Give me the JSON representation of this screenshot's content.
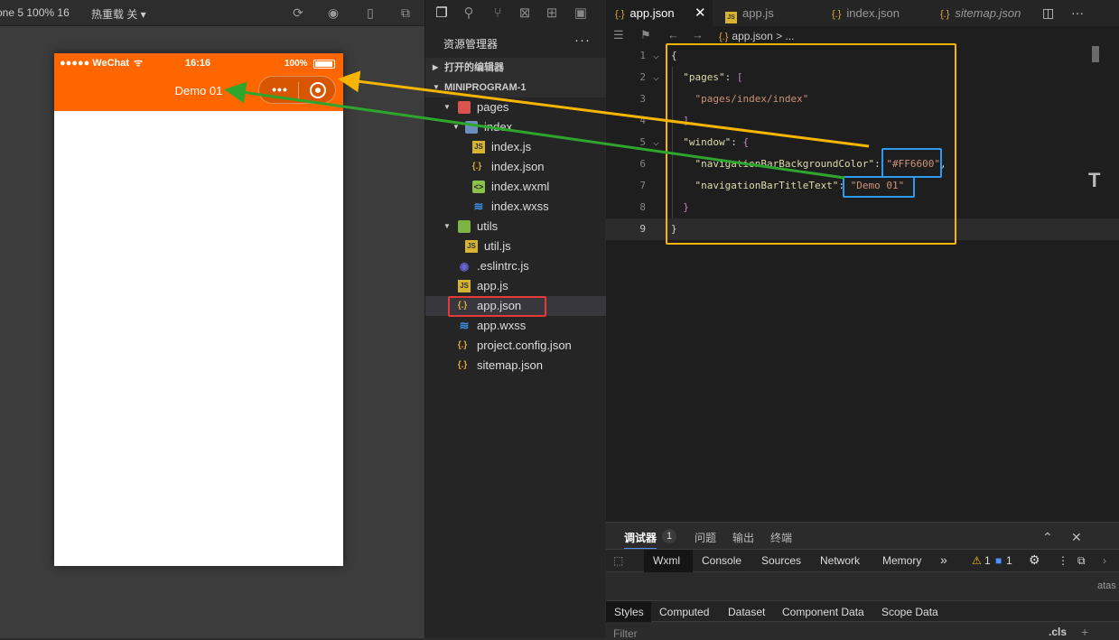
{
  "simulator": {
    "toolbar": {
      "device": "one 5 100% 16",
      "hotreload": "热重载 关"
    },
    "status_bar": {
      "carrier": "●●●●● WeChat",
      "time": "16:16",
      "battery": "100%"
    },
    "nav_title": "Demo 01",
    "nav_color": "#FF6600",
    "capsule_more": "•••"
  },
  "explorer": {
    "title": "资源管理器",
    "more": "···",
    "open_editors": "打开的编辑器",
    "project": "MINIPROGRAM-1",
    "tree": [
      {
        "label": "pages",
        "icon": "folder-red-icon"
      },
      {
        "label": "index",
        "icon": "folder-blue-icon"
      },
      {
        "label": "index.js",
        "icon": "js-icon"
      },
      {
        "label": "index.json",
        "icon": "json-icon"
      },
      {
        "label": "index.wxml",
        "icon": "wxml-icon"
      },
      {
        "label": "index.wxss",
        "icon": "wxss-icon"
      },
      {
        "label": "utils",
        "icon": "folder-green-icon"
      },
      {
        "label": "util.js",
        "icon": "js-icon"
      },
      {
        "label": ".eslintrc.js",
        "icon": "eslint-icon"
      },
      {
        "label": "app.js",
        "icon": "js-icon"
      },
      {
        "label": "app.json",
        "icon": "json-icon"
      },
      {
        "label": "app.wxss",
        "icon": "wxss-icon"
      },
      {
        "label": "project.config.json",
        "icon": "json-icon"
      },
      {
        "label": "sitemap.json",
        "icon": "json-icon"
      }
    ]
  },
  "editor": {
    "tabs": [
      {
        "label": "app.json",
        "icon": "json-icon"
      },
      {
        "label": "app.js",
        "icon": "js-icon"
      },
      {
        "label": "index.json",
        "icon": "json-icon"
      },
      {
        "label": "sitemap.json",
        "icon": "json-icon"
      }
    ],
    "tab_close": "✕",
    "breadcrumb": "app.json > ...",
    "json_brace": "{.}",
    "lines": [
      {
        "n": "1",
        "parts": [
          [
            "w",
            "{"
          ]
        ]
      },
      {
        "n": "2",
        "parts": [
          [
            "k",
            "  \"pages\""
          ],
          [
            "w",
            ": "
          ],
          [
            "p",
            "["
          ]
        ]
      },
      {
        "n": "3",
        "parts": [
          [
            "s",
            "    \"pages/index/index\""
          ]
        ]
      },
      {
        "n": "4",
        "parts": [
          [
            "p",
            "  ]"
          ],
          [
            "w",
            ","
          ]
        ]
      },
      {
        "n": "5",
        "parts": [
          [
            "k",
            "  \"window\""
          ],
          [
            "w",
            ": "
          ],
          [
            "p",
            "{"
          ]
        ]
      },
      {
        "n": "6",
        "parts": [
          [
            "k",
            "    \"navigationBarBackgroundColor\""
          ],
          [
            "w",
            ": "
          ],
          [
            "s",
            "\"#FF6600\""
          ],
          [
            "w",
            ","
          ]
        ]
      },
      {
        "n": "7",
        "parts": [
          [
            "k",
            "    \"navigationBarTitleText\""
          ],
          [
            "w",
            ": "
          ],
          [
            "s",
            "\"Demo 01\""
          ]
        ]
      },
      {
        "n": "8",
        "parts": [
          [
            "p",
            "  }"
          ]
        ]
      },
      {
        "n": "9",
        "parts": [
          [
            "w",
            "}"
          ]
        ]
      }
    ]
  },
  "devtools": {
    "top_tabs": [
      "调试器",
      "问题",
      "输出",
      "终端"
    ],
    "badge": "1",
    "tabs": [
      "Wxml",
      "Console",
      "Sources",
      "Network",
      "Memory"
    ],
    "overflow": "»",
    "warn_count": "1",
    "info_count": "1",
    "style_tabs": [
      "Styles",
      "Computed",
      "Dataset",
      "Component Data",
      "Scope Data"
    ],
    "filter_placeholder": "Filter",
    "cls": ".cls",
    "plus": "+",
    "side_text": "atas"
  },
  "colors": {
    "nav_orange": "#FF6600",
    "annotation_yellow": "#F7B500",
    "annotation_green": "#2EA62E",
    "annotation_blue": "#2E9AF0",
    "annotation_red": "#E53935"
  }
}
